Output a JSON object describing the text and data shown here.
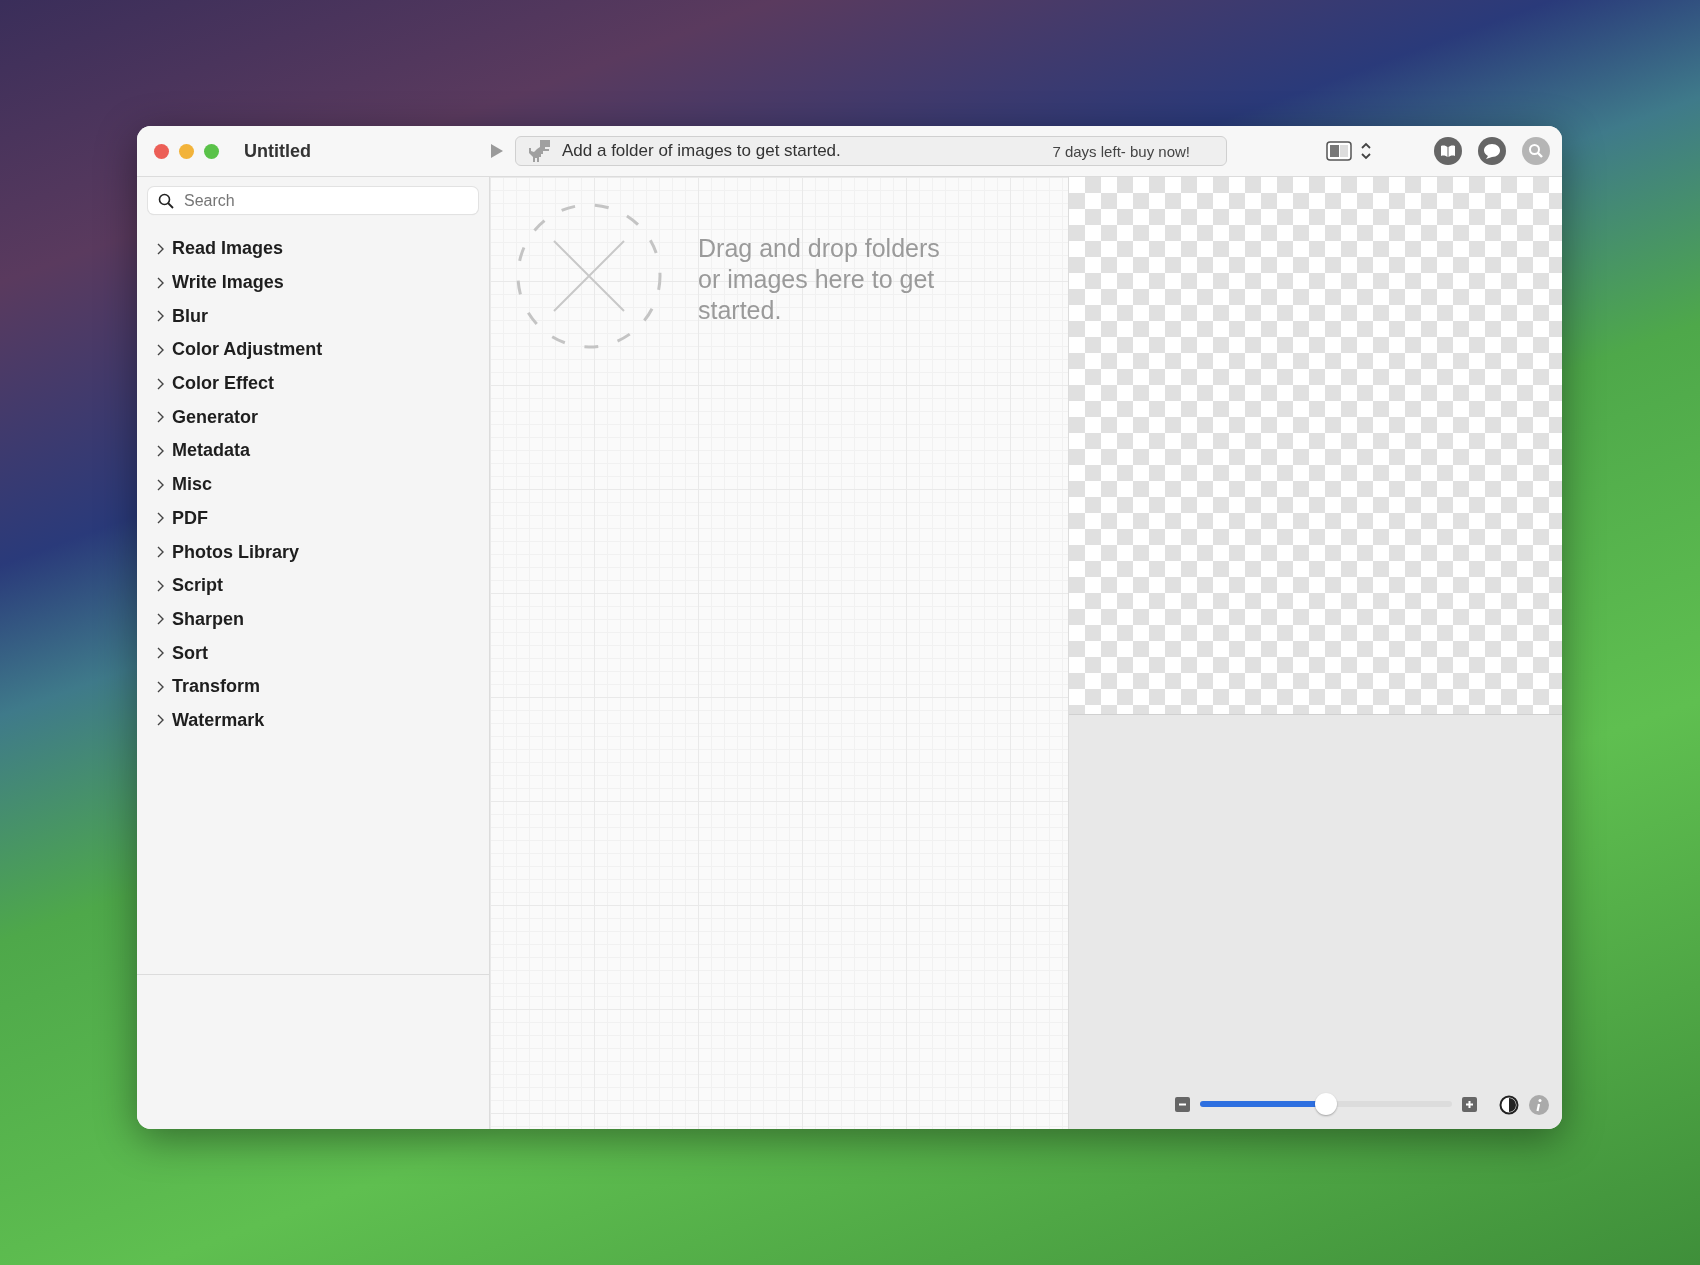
{
  "window": {
    "title": "Untitled"
  },
  "toolbar": {
    "status": "Add a folder of images to get started.",
    "trial": "7 days left- buy now!"
  },
  "sidebar": {
    "search": {
      "placeholder": "Search"
    },
    "items": [
      {
        "label": "Read Images",
        "expanded": false
      },
      {
        "label": "Write Images",
        "expanded": false
      },
      {
        "label": "Blur",
        "expanded": false
      },
      {
        "label": "Color Adjustment",
        "expanded": false
      },
      {
        "label": "Color Effect",
        "expanded": false
      },
      {
        "label": "Generator",
        "expanded": false
      },
      {
        "label": "Metadata",
        "expanded": false
      },
      {
        "label": "Misc",
        "expanded": false
      },
      {
        "label": "PDF",
        "expanded": false
      },
      {
        "label": "Photos Library",
        "expanded": false
      },
      {
        "label": "Script",
        "expanded": false
      },
      {
        "label": "Sharpen",
        "expanded": false
      },
      {
        "label": "Sort",
        "expanded": false
      },
      {
        "label": "Transform",
        "expanded": false
      },
      {
        "label": "Watermark",
        "expanded": false
      }
    ]
  },
  "canvas": {
    "hint": "Drag and drop folders or images here to get started."
  },
  "preview": {
    "zoom": {
      "level": 0.5
    }
  }
}
